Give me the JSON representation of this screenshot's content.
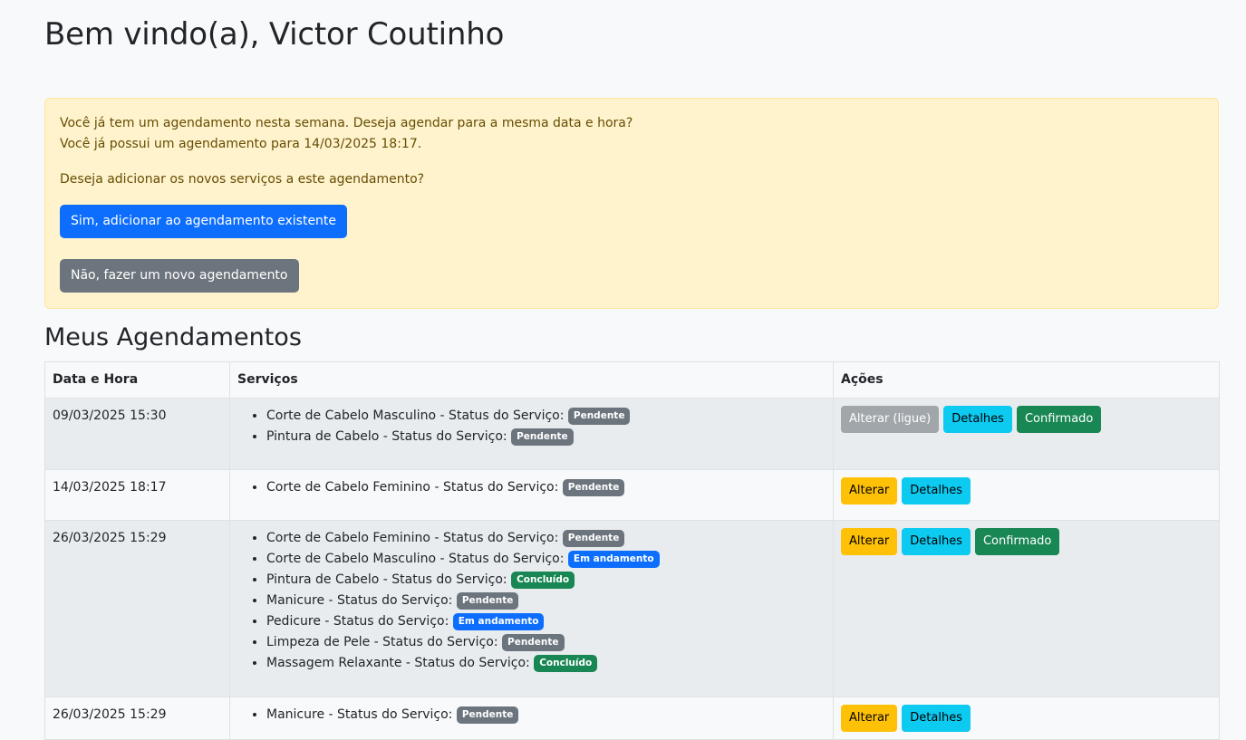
{
  "header": {
    "title": "Bem vindo(a), Victor Coutinho"
  },
  "alert": {
    "line1": "Você já tem um agendamento nesta semana. Deseja agendar para a mesma data e hora?",
    "line2": "Você já possui um agendamento para 14/03/2025 18:17.",
    "line3": "Deseja adicionar os novos serviços a este agendamento?",
    "btn_yes": "Sim, adicionar ao agendamento existente",
    "btn_no": "Não, fazer um novo agendamento"
  },
  "section": {
    "title": "Meus Agendamentos"
  },
  "table": {
    "headers": [
      "Data e Hora",
      "Serviços",
      "Ações"
    ],
    "service_status_prefix": " - Status do Serviço: ",
    "rows": [
      {
        "datetime": "09/03/2025 15:30",
        "services": [
          {
            "name": "Corte de Cabelo Masculino",
            "status": "Pendente"
          },
          {
            "name": "Pintura de Cabelo",
            "status": "Pendente"
          }
        ],
        "actions": [
          {
            "label": "Alterar (ligue)",
            "style": "disabled"
          },
          {
            "label": "Detalhes",
            "style": "info"
          },
          {
            "label": "Confirmado",
            "style": "success"
          }
        ]
      },
      {
        "datetime": "14/03/2025 18:17",
        "services": [
          {
            "name": "Corte de Cabelo Feminino",
            "status": "Pendente"
          }
        ],
        "actions": [
          {
            "label": "Alterar",
            "style": "warn"
          },
          {
            "label": "Detalhes",
            "style": "info"
          }
        ]
      },
      {
        "datetime": "26/03/2025 15:29",
        "services": [
          {
            "name": "Corte de Cabelo Feminino",
            "status": "Pendente"
          },
          {
            "name": "Corte de Cabelo Masculino",
            "status": "Em andamento"
          },
          {
            "name": "Pintura de Cabelo",
            "status": "Concluído"
          },
          {
            "name": "Manicure",
            "status": "Pendente"
          },
          {
            "name": "Pedicure",
            "status": "Em andamento"
          },
          {
            "name": "Limpeza de Pele",
            "status": "Pendente"
          },
          {
            "name": "Massagem Relaxante",
            "status": "Concluído"
          }
        ],
        "actions": [
          {
            "label": "Alterar",
            "style": "warn"
          },
          {
            "label": "Detalhes",
            "style": "info"
          },
          {
            "label": "Confirmado",
            "style": "success"
          }
        ]
      },
      {
        "datetime": "26/03/2025 15:29",
        "services": [
          {
            "name": "Manicure",
            "status": "Pendente"
          }
        ],
        "actions": [
          {
            "label": "Alterar",
            "style": "warn"
          },
          {
            "label": "Detalhes",
            "style": "info"
          }
        ]
      }
    ]
  },
  "colors": {
    "primary": "#0d6efd",
    "secondary": "#6c757d",
    "success": "#198754",
    "info": "#0dcaf0",
    "warning": "#ffc107",
    "alert_bg": "#fff3cd"
  }
}
